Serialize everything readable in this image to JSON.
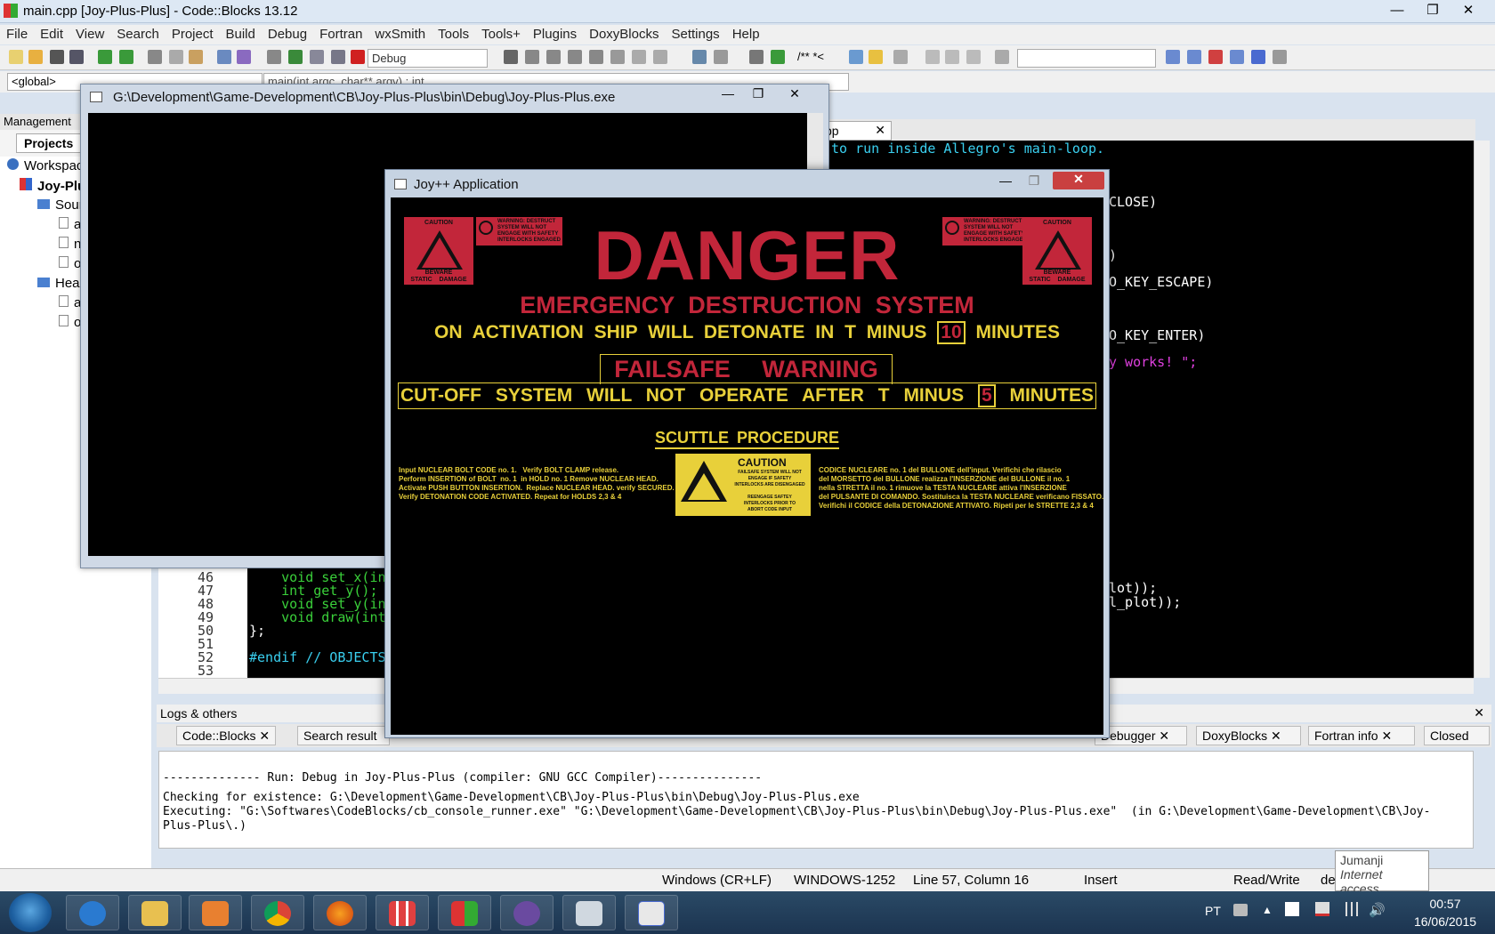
{
  "window": {
    "title": "main.cpp [Joy-Plus-Plus] - Code::Blocks 13.12",
    "min_glyph": "—",
    "max_glyph": "❐",
    "close_glyph": "✕"
  },
  "menu": [
    "File",
    "Edit",
    "View",
    "Search",
    "Project",
    "Build",
    "Debug",
    "Fortran",
    "wxSmith",
    "Tools",
    "Tools+",
    "Plugins",
    "DoxyBlocks",
    "Settings",
    "Help"
  ],
  "toolbar": {
    "build_target": "Debug",
    "global_scope": "<global>",
    "function_scope": "main(int argc, char** argv) : int",
    "doxy_comment": "/** *<"
  },
  "management": {
    "header": "Management",
    "projects_tab": "Projects",
    "tree": [
      {
        "label": "Workspace",
        "level": 0
      },
      {
        "label": "Joy-Plus-Plus",
        "level": 0,
        "bold": true
      },
      {
        "label": "Sources",
        "level": 1
      },
      {
        "label": "a",
        "level": 2
      },
      {
        "label": "n",
        "level": 2
      },
      {
        "label": "o",
        "level": 2
      },
      {
        "label": "Headers",
        "level": 1
      },
      {
        "label": "a",
        "level": 2
      },
      {
        "label": "o",
        "level": 2
      }
    ]
  },
  "editor": {
    "tab_label": "pp",
    "right_code": [
      {
        "text": "to run inside Allegro's main-loop.",
        "color": "#3ad0f0"
      },
      {
        "text": "CLOSE)",
        "color": "#ffffff"
      },
      {
        "text": ")",
        "color": "#ffffff"
      },
      {
        "text": "O_KEY_ESCAPE)",
        "color": "#ffffff"
      },
      {
        "text": "O_KEY_ENTER)",
        "color": "#ffffff"
      },
      {
        "text": "y works! \";",
        "color": "#e040e0"
      },
      {
        "text": "lot));",
        "color": "#ffffff"
      },
      {
        "text": "l_plot));",
        "color": "#ffffff"
      }
    ],
    "lines": [
      {
        "num": "46",
        "code": "    void set_x(in"
      },
      {
        "num": "47",
        "code": "    int get_y();"
      },
      {
        "num": "48",
        "code": "    void set_y(in"
      },
      {
        "num": "49",
        "code": "    void draw(int"
      },
      {
        "num": "50",
        "code": "};"
      },
      {
        "num": "51",
        "code": ""
      },
      {
        "num": "52",
        "code": "#endif // OBJECTS"
      },
      {
        "num": "53",
        "code": ""
      }
    ]
  },
  "logs": {
    "header": "Logs & others",
    "tabs": [
      "Code::Blocks",
      "Search result",
      "Debugger",
      "DoxyBlocks",
      "Fortran info",
      "Closed"
    ],
    "lines": [
      "-------------- Run: Debug in Joy-Plus-Plus (compiler: GNU GCC Compiler)---------------",
      "Checking for existence: G:\\Development\\Game-Development\\CB\\Joy-Plus-Plus\\bin\\Debug\\Joy-Plus-Plus.exe",
      "Executing: \"G:\\Softwares\\CodeBlocks/cb_console_runner.exe\" \"G:\\Development\\Game-Development\\CB\\Joy-Plus-Plus\\bin\\Debug\\Joy-Plus-Plus.exe\"  (in G:\\Development\\Game-Development\\CB\\Joy-",
      "Plus-Plus\\.)"
    ]
  },
  "statusbar": {
    "line_endings": "Windows (CR+LF)",
    "encoding": "WINDOWS-1252",
    "position": "Line 57, Column 16",
    "mode": "Insert",
    "access": "Read/Write",
    "extra": "de"
  },
  "tooltip": {
    "title": "Jumanji",
    "subtitle": "Internet access"
  },
  "console": {
    "title": "G:\\Development\\Game-Development\\CB\\Joy-Plus-Plus\\bin\\Debug\\Joy-Plus-Plus.exe"
  },
  "joy": {
    "title": "Joy++ Application",
    "danger": "DANGER",
    "eds": "EMERGENCY DESTRUCTION SYSTEM",
    "activation_pre": "ON ACTIVATION SHIP WILL DETONATE IN T MINUS",
    "activation_num": "10",
    "activation_post": "MINUTES",
    "failsafe": "FAILSAFE WARNING",
    "cutoff_pre": "CUT-OFF SYSTEM WILL NOT OPERATE AFTER T MINUS",
    "cutoff_num": "5",
    "cutoff_post": "MINUTES",
    "scuttle": "SCUTTLE PROCEDURE",
    "left_text": "Input NUCLEAR BOLT CODE no. 1.   Verify BOLT CLAMP release.\nPerform INSERTION of BOLT  no. 1  in HOLD no. 1 Remove NUCLEAR HEAD.\nActivate PUSH BUTTON INSERTION.  Replace NUCLEAR HEAD. verify SECURED.\nVerify DETONATION CODE ACTIVATED. Repeat for HOLDS 2,3 & 4",
    "right_text": "CODICE NUCLEARE no. 1 del BULLONE dell'input. Verifichi che rilascio\ndel MORSETTO del BULLONE realizza l'INSERZIONE del BULLONE il no. 1\nnella STRETTA il no. 1 rimuove la TESTA NUCLEARE attiva l'INSERZIONE\ndel PULSANTE DI COMANDO. Sostituisca la TESTA NUCLEARE verificano FISSATO.\nVerifichi il CODICE della DETONAZIONE ATTIVATO. Ripeti per le STRETTE 2,3 & 4",
    "caution": "CAUTION",
    "yellow_caution_text": "FAILSAFE SYSTEM WILL NOT\nENGAGE IF SAFETY\nINTERLOCKS ARE DISENGAGED\n\nREENGAGE SAFTEY\nINTERLOCKS PRIOR TO\nABORT CODE INPUT",
    "sign_bottom": "BEWARE\nSTATIC    DAMAGE",
    "warning_label": "WARNING: DESTRUCT\nSYSTEM WILL NOT\nENGAGE WITH SAFETY\nINTERLOCKS ENGAGED"
  },
  "taskbar": {
    "lang": "PT",
    "time": "00:57",
    "date": "16/06/2015"
  }
}
